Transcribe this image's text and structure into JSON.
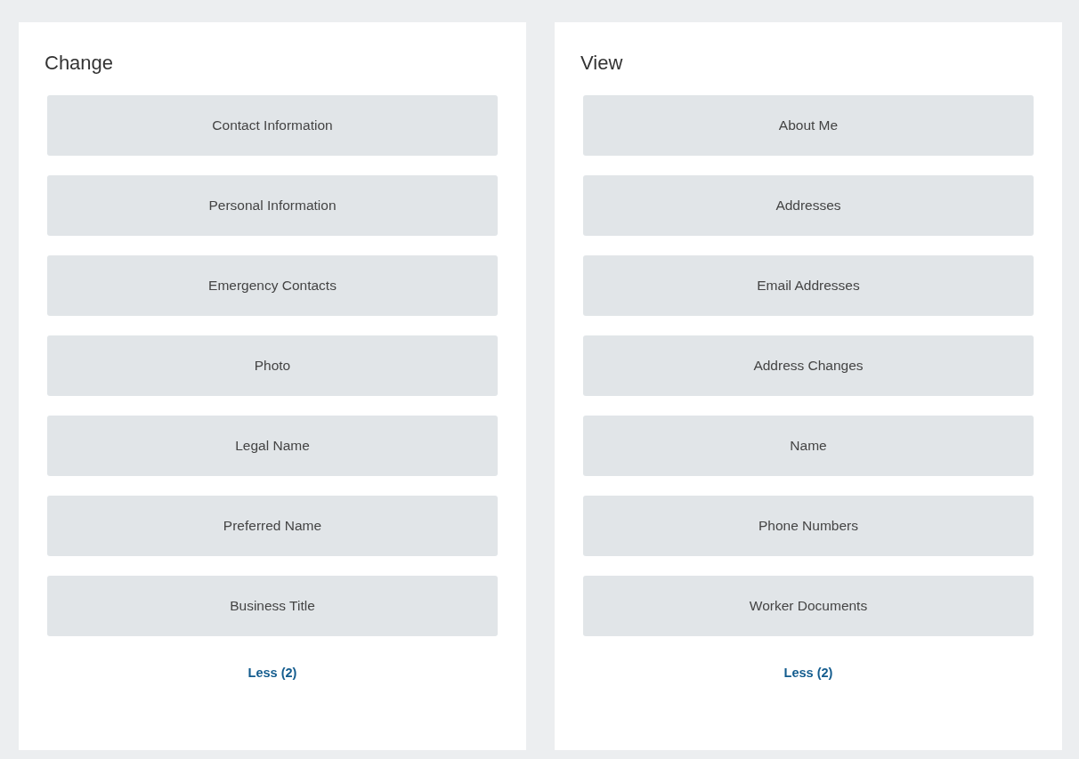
{
  "panels": [
    {
      "title": "Change",
      "buttons": [
        "Contact Information",
        "Personal Information",
        "Emergency Contacts",
        "Photo",
        "Legal Name",
        "Preferred Name",
        "Business Title"
      ],
      "link": "Less (2)"
    },
    {
      "title": "View",
      "buttons": [
        "About Me",
        "Addresses",
        "Email Addresses",
        "Address Changes",
        "Name",
        "Phone Numbers",
        "Worker Documents"
      ],
      "link": "Less (2)"
    }
  ]
}
